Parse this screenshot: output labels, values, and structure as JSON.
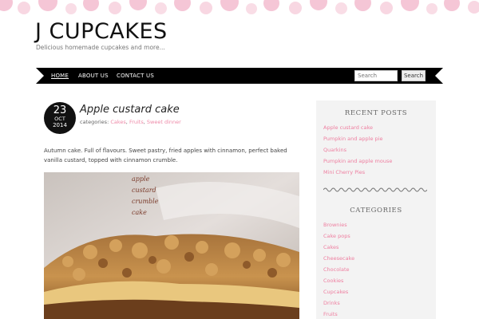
{
  "site": {
    "title": "J CUPCAKES",
    "tagline": "Delicious homemade cupcakes and more...",
    "header_dot_color": "#f5c6d6"
  },
  "nav": {
    "items": [
      {
        "label": "HOME",
        "active": true
      },
      {
        "label": "ABOUT US",
        "active": false
      },
      {
        "label": "CONTACT US",
        "active": false
      }
    ],
    "search_placeholder": "Search",
    "search_button": "Search"
  },
  "post": {
    "date": {
      "day": "23",
      "month": "OCT",
      "year": "2014"
    },
    "title": "Apple custard cake",
    "categories_label": "categories:",
    "categories": [
      "Cakes",
      "Fruits",
      "Sweet dinner"
    ],
    "excerpt": "Autumn cake. Full of flavours. Sweet pastry, fried apples with cinnamon, perfect baked vanilla custard, topped with cinnamon crumble.",
    "photo_caption": [
      "apple",
      "custard",
      "crumble",
      "cake"
    ]
  },
  "sidebar": {
    "recent_posts": {
      "title": "RECENT POSTS",
      "items": [
        "Apple custard cake",
        "Pumpkin and apple pie",
        "Quarkins",
        "Pumpkin and apple mouse",
        "Mini Cherry Pies"
      ]
    },
    "categories": {
      "title": "CATEGORIES",
      "items": [
        "Brownies",
        "Cake pops",
        "Cakes",
        "Cheesecake",
        "Chocolate",
        "Cookies",
        "Cupcakes",
        "Drinks",
        "Fruits"
      ]
    }
  },
  "colors": {
    "accent_pink": "#ee7fa0",
    "nav_bg": "#000000",
    "sidebar_bg": "#f3f3f3"
  }
}
